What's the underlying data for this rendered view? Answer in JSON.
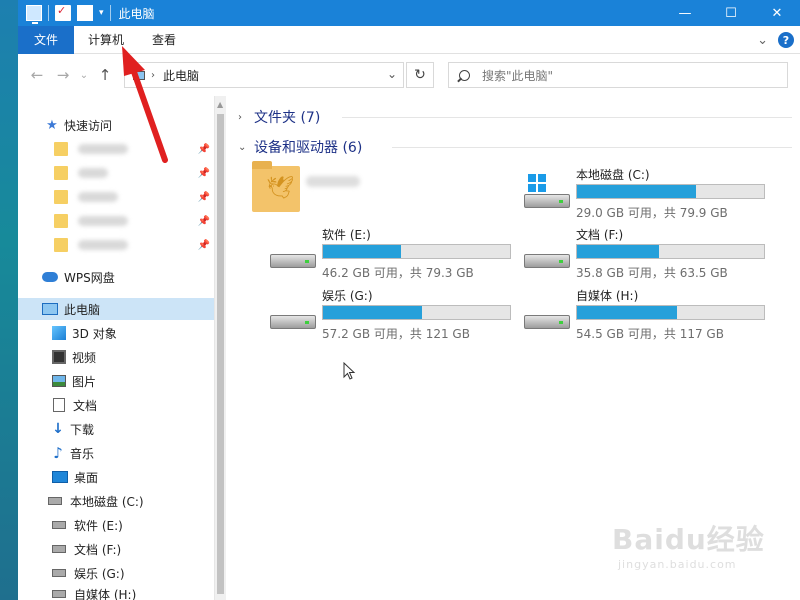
{
  "titlebar": {
    "title": "此电脑",
    "minimize": "—",
    "maximize": "☐",
    "close": "✕"
  },
  "ribbon": {
    "tabs": [
      "文件",
      "计算机",
      "查看"
    ],
    "expand": "⌄",
    "help": "?"
  },
  "nav": {
    "back": "←",
    "forward": "→",
    "recent": "⌄",
    "up": "↑",
    "address": "此电脑",
    "address_dropdown": "⌄",
    "refresh": "↻",
    "search_placeholder": "搜索\"此电脑\""
  },
  "sidebar": {
    "quick_access": "快速访问",
    "wps": "WPS网盘",
    "this_pc": "此电脑",
    "items": [
      {
        "label": "3D 对象",
        "icon": "3d-objects-icon"
      },
      {
        "label": "视频",
        "icon": "video-icon"
      },
      {
        "label": "图片",
        "icon": "pictures-icon"
      },
      {
        "label": "文档",
        "icon": "documents-icon"
      },
      {
        "label": "下载",
        "icon": "downloads-icon"
      },
      {
        "label": "音乐",
        "icon": "music-icon"
      },
      {
        "label": "桌面",
        "icon": "desktop-icon"
      },
      {
        "label": "本地磁盘 (C:)",
        "icon": "drive-icon"
      },
      {
        "label": "软件 (E:)",
        "icon": "drive-icon"
      },
      {
        "label": "文档 (F:)",
        "icon": "drive-icon"
      },
      {
        "label": "娱乐 (G:)",
        "icon": "drive-icon"
      },
      {
        "label": "自媒体 (H:)",
        "icon": "drive-icon"
      }
    ]
  },
  "main": {
    "folders_header": "文件夹 (7)",
    "devices_header": "设备和驱动器 (6)",
    "drives": [
      {
        "name": "本地磁盘 (C:)",
        "info": "29.0 GB 可用，共 79.9 GB",
        "used_fraction": 0.637
      },
      {
        "name": "软件 (E:)",
        "info": "46.2 GB 可用，共 79.3 GB",
        "used_fraction": 0.417
      },
      {
        "name": "文档 (F:)",
        "info": "35.8 GB 可用，共 63.5 GB",
        "used_fraction": 0.436
      },
      {
        "name": "娱乐 (G:)",
        "info": "57.2 GB 可用，共 121 GB",
        "used_fraction": 0.527
      },
      {
        "name": "自媒体 (H:)",
        "info": "54.5 GB 可用，共 117 GB",
        "used_fraction": 0.534
      }
    ]
  },
  "watermark": {
    "logo": "Baidu经验",
    "url": "jingyan.baidu.com"
  },
  "colors": {
    "titlebar": "#1a82d8",
    "file_tab": "#1a6fc9",
    "progress": "#26a0da",
    "selection": "#cce4f7",
    "annotation_arrow": "#e02020"
  }
}
